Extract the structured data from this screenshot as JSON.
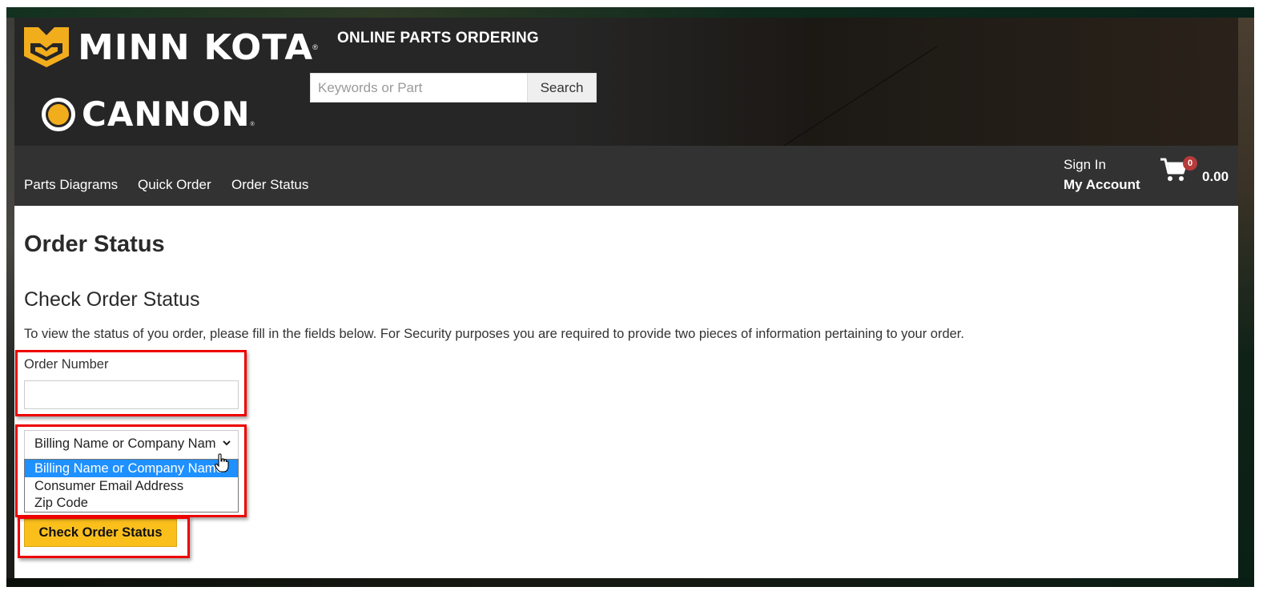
{
  "header": {
    "brand_primary": "MINN KOTA",
    "brand_secondary": "CANNON",
    "registered_mark": "®",
    "site_title": "ONLINE PARTS ORDERING",
    "search": {
      "placeholder": "Keywords or Part",
      "value": "",
      "button_label": "Search"
    }
  },
  "nav": {
    "items": [
      {
        "label": "Parts Diagrams"
      },
      {
        "label": "Quick Order"
      },
      {
        "label": "Order Status"
      }
    ],
    "sign_in": "Sign In",
    "my_account": "My Account",
    "cart": {
      "icon": "shopping-cart-icon",
      "count": "0",
      "total": "0.00"
    }
  },
  "main": {
    "page_title": "Order Status",
    "section_title": "Check Order Status",
    "intro": "To view the status of you order, please fill in the fields below. For Security purposes you are required to provide two pieces of information pertaining to your order.",
    "order_number": {
      "label": "Order Number",
      "value": ""
    },
    "lookup_select": {
      "selected": "Billing Name or Company Name",
      "options": [
        "Billing Name or Company Name",
        "Consumer Email Address",
        "Zip Code"
      ],
      "highlighted_index": 0
    },
    "submit_label": "Check Order Status"
  },
  "colors": {
    "accent_yellow": "#fbbf1c",
    "logo_yellow": "#f2ad1d",
    "header_dark": "#262626",
    "nav_dark": "#323232",
    "cart_badge": "#b83a3a",
    "highlight_red": "#ee0000",
    "option_selected": "#1e90ff"
  }
}
